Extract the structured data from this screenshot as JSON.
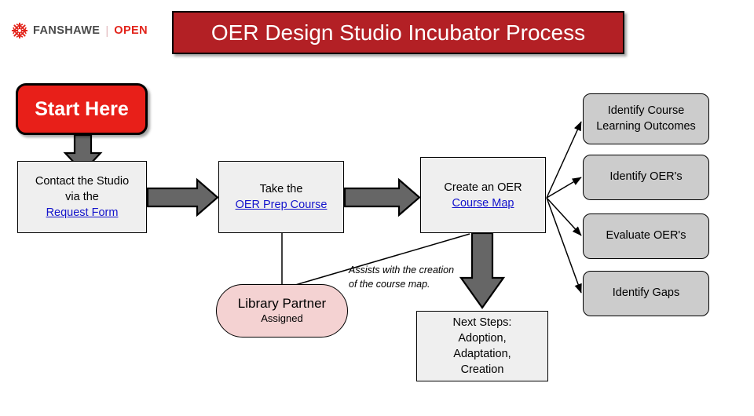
{
  "brand": {
    "mark_icon": "fanshawe-snowflake-icon",
    "word": "FANSHAWE",
    "divider": "|",
    "open": "OPEN",
    "mark_color": "#e2231a",
    "word_color": "#4a4a4a",
    "open_color": "#e2231a"
  },
  "header": {
    "title": "OER Design Studio Incubator Process",
    "banner_bg": "#b32025",
    "banner_text_color": "#ffffff"
  },
  "start": {
    "label": "Start Here",
    "bg": "#e81f19",
    "text_color": "#ffffff"
  },
  "flow": {
    "box_fill": "#efefef",
    "link_color": "#1414cc",
    "arrow_fill": "#666666",
    "boxes": [
      {
        "id": "contact",
        "line1": "Contact the Studio",
        "line2": "via the",
        "link": "Request Form"
      },
      {
        "id": "prep",
        "line1": "Take the",
        "link": "OER Prep Course"
      },
      {
        "id": "map",
        "line1": "Create an OER",
        "link": "Course Map"
      },
      {
        "id": "next",
        "line1": "Next Steps:",
        "line2": "Adoption,",
        "line3": "Adaptation,",
        "line4": "Creation"
      }
    ]
  },
  "library_partner": {
    "title": "Library Partner",
    "subtitle": "Assigned",
    "fill": "#f4d2d2"
  },
  "annotation": {
    "text": "Assists with the creation of the course map."
  },
  "outcomes": {
    "fill": "#cccccc",
    "items": [
      {
        "label": "Identify Course Learning Outcomes"
      },
      {
        "label": "Identify OER's"
      },
      {
        "label": "Evaluate OER's"
      },
      {
        "label": "Identify Gaps"
      }
    ]
  }
}
